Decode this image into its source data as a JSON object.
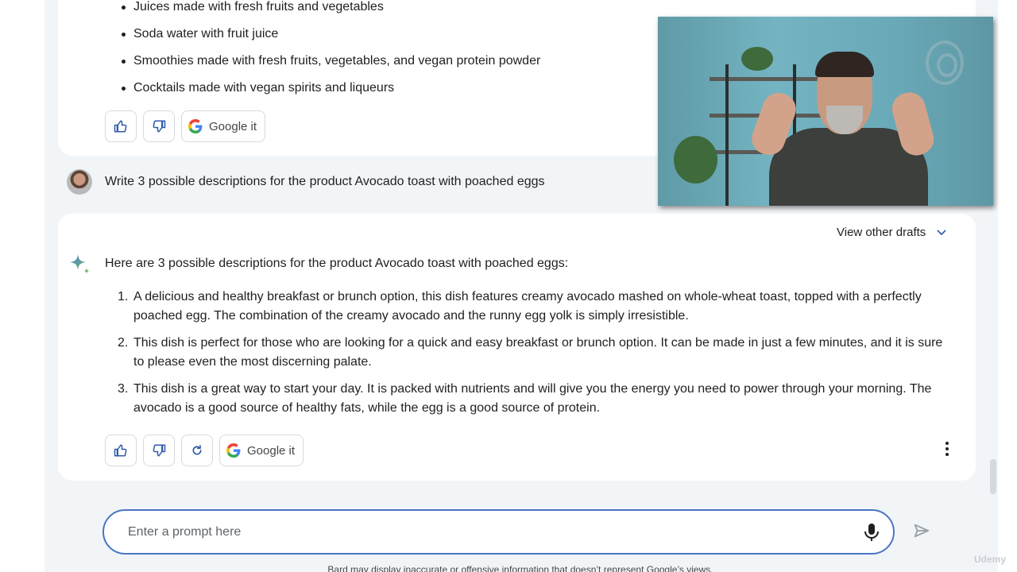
{
  "previous_response": {
    "bullets": [
      "Juices made with fresh fruits and vegetables",
      "Soda water with fruit juice",
      "Smoothies made with fresh fruits, vegetables, and vegan protein powder",
      "Cocktails made with vegan spirits and liqueurs"
    ],
    "actions": {
      "thumbs_up_icon": "thumbs-up-icon",
      "thumbs_down_icon": "thumbs-down-icon",
      "google_it_label": "Google it"
    }
  },
  "user_prompt": {
    "text": "Write 3 possible descriptions for the product Avocado toast with poached eggs"
  },
  "response": {
    "view_drafts_label": "View other drafts",
    "intro": "Here are 3 possible descriptions for the product Avocado toast with poached eggs:",
    "items": [
      {
        "num": "1.",
        "text": "A delicious and healthy breakfast or brunch option, this dish features creamy avocado mashed on whole-wheat toast, topped with a perfectly poached egg. The combination of the creamy avocado and the runny egg yolk is simply irresistible."
      },
      {
        "num": "2.",
        "text": "This dish is perfect for those who are looking for a quick and easy breakfast or brunch option. It can be made in just a few minutes, and it is sure to please even the most discerning palate."
      },
      {
        "num": "3.",
        "text": "This dish is a great way to start your day. It is packed with nutrients and will give you the energy you need to power through your morning. The avocado is a good source of healthy fats, while the egg is a good source of protein."
      }
    ],
    "actions": {
      "google_it_label": "Google it"
    }
  },
  "prompt_bar": {
    "placeholder": "Enter a prompt here",
    "value": ""
  },
  "disclaimer": "Bard may display inaccurate or offensive information that doesn’t represent Google’s views.",
  "watermark": "Udemy",
  "colors": {
    "accent_blue": "#4a75c3",
    "icon_blue": "#2f5aa8",
    "panel_bg": "#f2f5f8"
  }
}
